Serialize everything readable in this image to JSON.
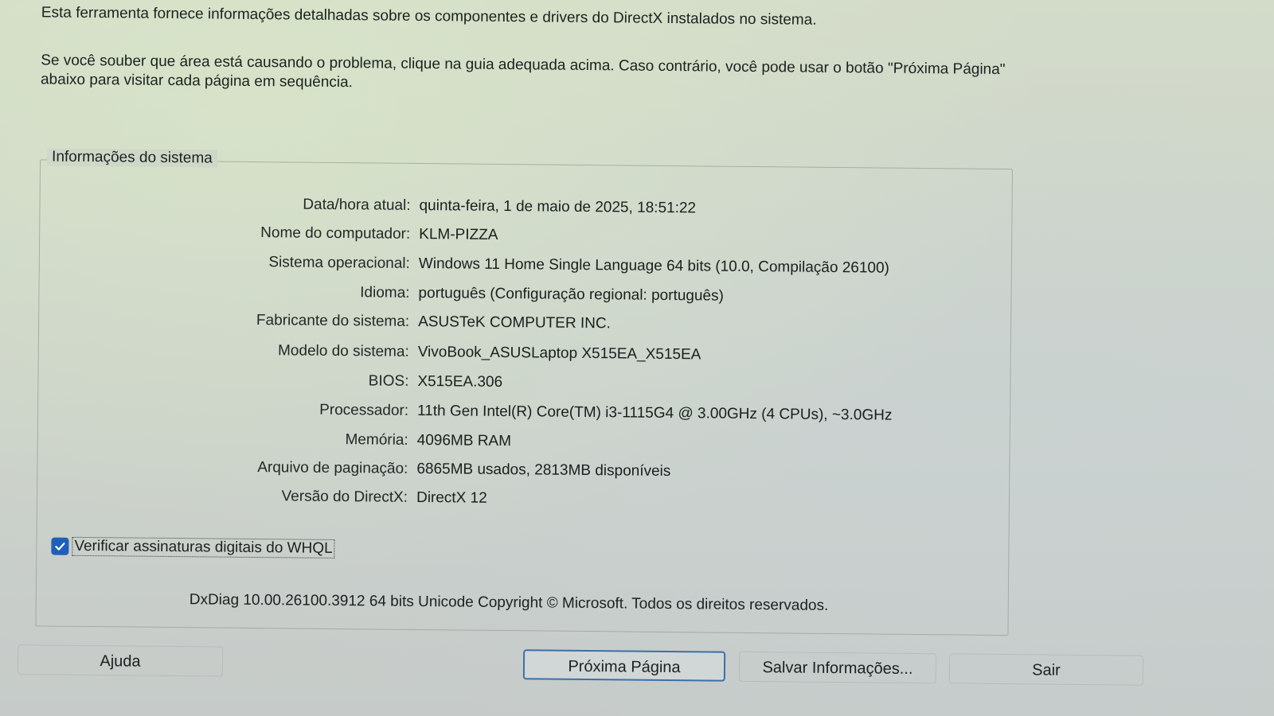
{
  "intro": {
    "line1": "Esta ferramenta fornece informações detalhadas sobre os componentes e drivers do DirectX instalados no sistema.",
    "line2": "Se você souber que área está causando o problema, clique na guia adequada acima. Caso contrário, você pode usar o botão \"Próxima Página\" abaixo para visitar cada página em sequência."
  },
  "system_info": {
    "title": "Informações do sistema",
    "rows": [
      {
        "label": "Data/hora atual:",
        "value": "quinta-feira, 1 de maio de 2025, 18:51:22"
      },
      {
        "label": "Nome do computador:",
        "value": "KLM-PIZZA"
      },
      {
        "label": "Sistema operacional:",
        "value": "Windows 11 Home Single Language 64 bits (10.0, Compilação 26100)"
      },
      {
        "label": "Idioma:",
        "value": "português (Configuração regional: português)"
      },
      {
        "label": "Fabricante do sistema:",
        "value": "ASUSTeK COMPUTER INC."
      },
      {
        "label": "Modelo do sistema:",
        "value": "VivoBook_ASUSLaptop X515EA_X515EA"
      },
      {
        "label": "BIOS:",
        "value": "X515EA.306"
      },
      {
        "label": "Processador:",
        "value": "11th Gen Intel(R) Core(TM) i3-1115G4 @ 3.00GHz (4 CPUs), ~3.0GHz"
      },
      {
        "label": "Memória:",
        "value": "4096MB RAM"
      },
      {
        "label": "Arquivo de paginação:",
        "value": "6865MB usados, 2813MB disponíveis"
      },
      {
        "label": "Versão do DirectX:",
        "value": "DirectX 12"
      }
    ]
  },
  "whql": {
    "label": "Verificar assinaturas digitais do WHQL",
    "checked": true
  },
  "footer": {
    "copyright": "DxDiag 10.00.26100.3912 64 bits Unicode  Copyright © Microsoft. Todos os direitos reservados."
  },
  "buttons": {
    "help": "Ajuda",
    "next_page": "Próxima Página",
    "save_info": "Salvar Informações...",
    "exit": "Sair"
  },
  "colors": {
    "checkbox_accent": "#1f5fb8",
    "default_button_border": "#3d6fa8"
  }
}
